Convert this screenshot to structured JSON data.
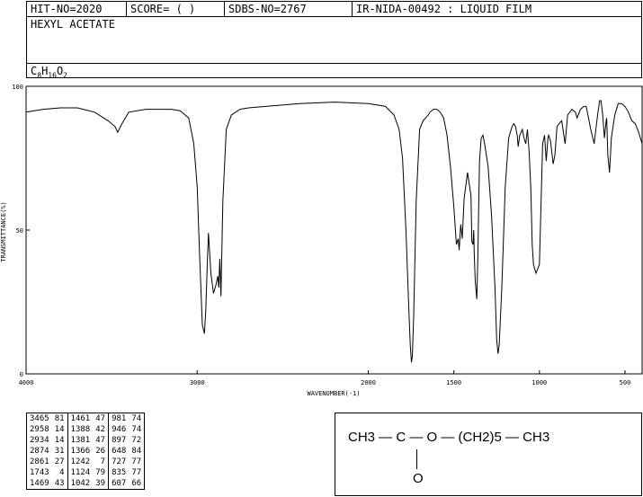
{
  "header": {
    "hit": "HIT-NO=2020",
    "score": "SCORE=  (   )",
    "sdbs": "SDBS-NO=2767",
    "ir": "IR-NIDA-00492 : LIQUID FILM",
    "compound": "HEXYL ACETATE",
    "formula": {
      "c": "C",
      "c_n": "8",
      "h": "H",
      "h_n": "16",
      "o": "O",
      "o_n": "2"
    }
  },
  "chart_data": {
    "type": "line",
    "xlabel": "WAVENUMBER(-1)",
    "ylabel": "TRANSMITTANCE(%)",
    "xlim": [
      4000,
      400
    ],
    "ylim": [
      0,
      100
    ],
    "xticks": [
      4000,
      3000,
      2000,
      1500,
      1000,
      500
    ],
    "yticks": [
      0,
      50,
      100
    ],
    "x": [
      4000,
      3900,
      3800,
      3700,
      3600,
      3520,
      3480,
      3465,
      3440,
      3400,
      3300,
      3200,
      3150,
      3100,
      3050,
      3020,
      3000,
      2985,
      2970,
      2958,
      2950,
      2940,
      2934,
      2920,
      2905,
      2890,
      2880,
      2874,
      2868,
      2861,
      2850,
      2830,
      2800,
      2750,
      2700,
      2600,
      2400,
      2200,
      2000,
      1950,
      1900,
      1850,
      1820,
      1800,
      1780,
      1765,
      1755,
      1748,
      1743,
      1735,
      1720,
      1700,
      1680,
      1650,
      1640,
      1620,
      1600,
      1580,
      1560,
      1540,
      1520,
      1500,
      1485,
      1475,
      1469,
      1460,
      1451,
      1440,
      1420,
      1400,
      1395,
      1388,
      1384,
      1381,
      1375,
      1366,
      1360,
      1350,
      1340,
      1330,
      1320,
      1300,
      1280,
      1260,
      1250,
      1242,
      1235,
      1220,
      1200,
      1180,
      1160,
      1150,
      1140,
      1130,
      1124,
      1115,
      1100,
      1090,
      1080,
      1070,
      1060,
      1050,
      1042,
      1035,
      1020,
      1000,
      990,
      981,
      970,
      960,
      950,
      946,
      935,
      920,
      910,
      897,
      885,
      870,
      850,
      835,
      810,
      790,
      780,
      760,
      740,
      727,
      720,
      700,
      680,
      660,
      648,
      640,
      630,
      620,
      610,
      607,
      600,
      590,
      580,
      560,
      540,
      520,
      500,
      480,
      460,
      440,
      420,
      400
    ],
    "y": [
      91,
      92,
      92.5,
      92.5,
      91,
      88,
      86,
      84,
      87,
      91,
      92,
      92,
      92,
      91.5,
      89,
      80,
      65,
      40,
      17,
      14,
      22,
      40,
      49,
      35,
      28,
      31,
      34,
      30,
      40,
      27,
      60,
      85,
      90,
      92,
      92.5,
      93,
      94,
      94.5,
      94,
      93.5,
      93,
      90,
      85,
      75,
      50,
      25,
      10,
      4,
      6,
      20,
      60,
      85,
      88,
      90,
      91,
      92,
      92,
      91,
      89,
      83,
      72,
      58,
      45,
      47,
      43,
      52,
      47,
      61,
      70,
      62,
      46,
      45,
      50,
      42,
      32,
      26,
      40,
      74,
      82,
      83,
      80,
      72,
      55,
      30,
      12,
      7,
      10,
      30,
      65,
      82,
      86,
      87,
      86,
      83,
      79,
      83,
      85,
      82,
      80,
      85,
      77,
      64,
      45,
      38,
      35,
      38,
      60,
      80,
      83,
      74,
      82,
      83,
      81,
      73,
      76,
      86,
      87,
      88,
      80,
      90,
      92,
      91,
      89,
      92,
      93,
      93,
      91,
      85,
      80,
      90,
      95,
      95,
      90,
      82,
      88,
      89,
      76,
      70,
      82,
      90,
      94,
      94,
      93,
      91,
      88,
      87,
      84,
      80,
      76
    ]
  },
  "peaks": [
    [
      "3465",
      "81",
      "1461",
      "47",
      "981",
      "74"
    ],
    [
      "2958",
      "14",
      "1388",
      "42",
      "946",
      "74"
    ],
    [
      "2934",
      "14",
      "1381",
      "47",
      "897",
      "72"
    ],
    [
      "2874",
      "31",
      "1366",
      "26",
      "648",
      "84"
    ],
    [
      "2861",
      "27",
      "1242",
      "7",
      "727",
      "77"
    ],
    [
      "1743",
      "4",
      "1124",
      "79",
      "835",
      "77"
    ],
    [
      "1469",
      "43",
      "1042",
      "39",
      "607",
      "66"
    ]
  ],
  "structure": {
    "line": "CH3 — C — O — (CH2)5 — CH3",
    "o": "O"
  }
}
